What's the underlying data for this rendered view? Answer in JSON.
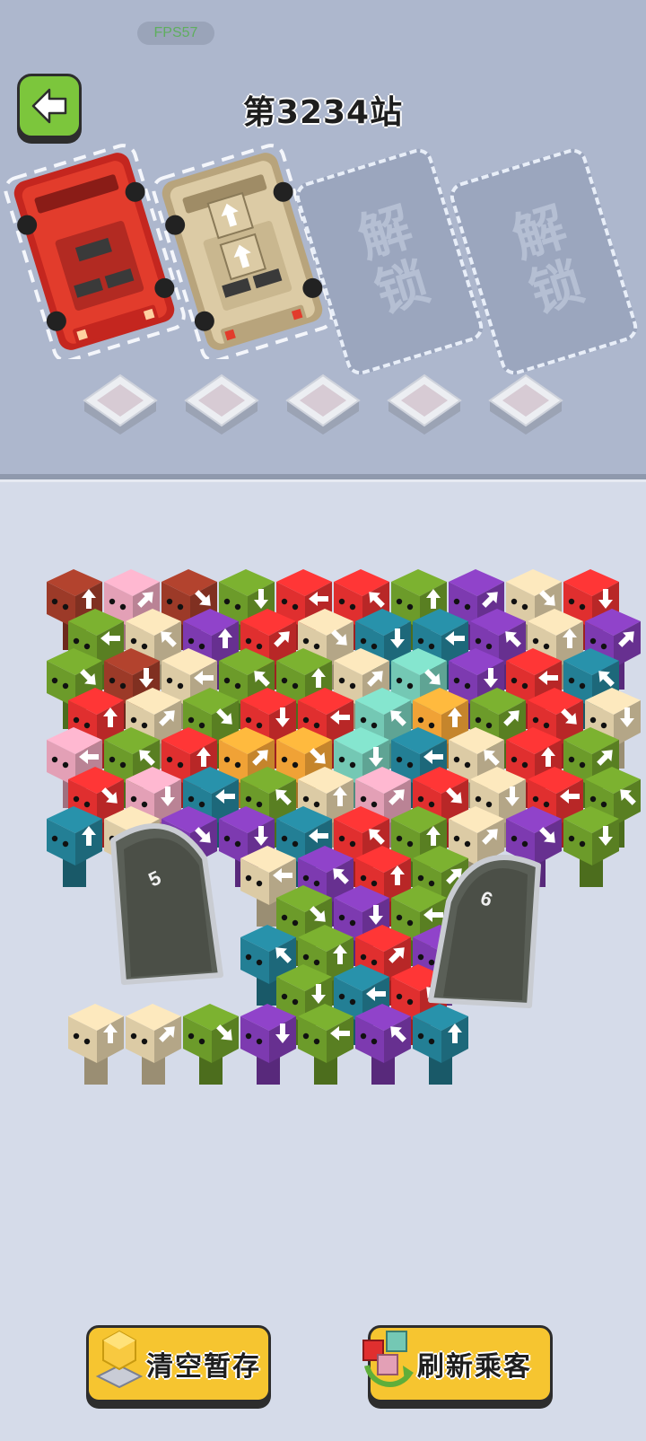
{
  "hud": {
    "fps": "FPS57",
    "title": "第3234站"
  },
  "slots": {
    "locked_label": "解锁",
    "buses": [
      {
        "color": "#e23c2c",
        "passengers": 0
      },
      {
        "color": "#dccba5",
        "passengers": 2
      }
    ]
  },
  "buffer_tiles": 5,
  "gates": {
    "left": "5",
    "right": "6"
  },
  "buttons": {
    "clear": "清空暂存",
    "refresh": "刷新乘客"
  },
  "colors": {
    "red": "#e02f2f",
    "beige": "#dccba5",
    "green": "#6c9b2a",
    "purple": "#7d3ab0",
    "teal": "#237f95",
    "pink": "#e3a0b6",
    "brown": "#9c3a28",
    "orange": "#f0a236",
    "mint": "#74c8b4"
  },
  "passenger_colors": [
    "brown",
    "pink",
    "brown",
    "green",
    "red",
    "red",
    "green",
    "purple",
    "beige",
    "red",
    "green",
    "beige",
    "purple",
    "red",
    "beige",
    "teal",
    "teal",
    "purple",
    "beige",
    "purple",
    "green",
    "brown",
    "beige",
    "green",
    "green",
    "beige",
    "mint",
    "purple",
    "red",
    "teal",
    "red",
    "beige",
    "green",
    "red",
    "red",
    "mint",
    "orange",
    "green",
    "red",
    "beige",
    "pink",
    "green",
    "red",
    "orange",
    "orange",
    "mint",
    "teal",
    "beige",
    "red",
    "green",
    "red",
    "pink",
    "teal",
    "green",
    "beige",
    "pink",
    "red",
    "beige",
    "red",
    "green",
    "teal",
    "beige",
    "purple",
    "purple",
    "teal",
    "red",
    "green",
    "beige",
    "purple",
    "green",
    "beige",
    "purple",
    "red",
    "green",
    "green",
    "purple",
    "green",
    "teal",
    "green",
    "red",
    "purple",
    "green",
    "teal",
    "red",
    "beige",
    "beige",
    "green",
    "purple",
    "green",
    "purple",
    "teal"
  ]
}
